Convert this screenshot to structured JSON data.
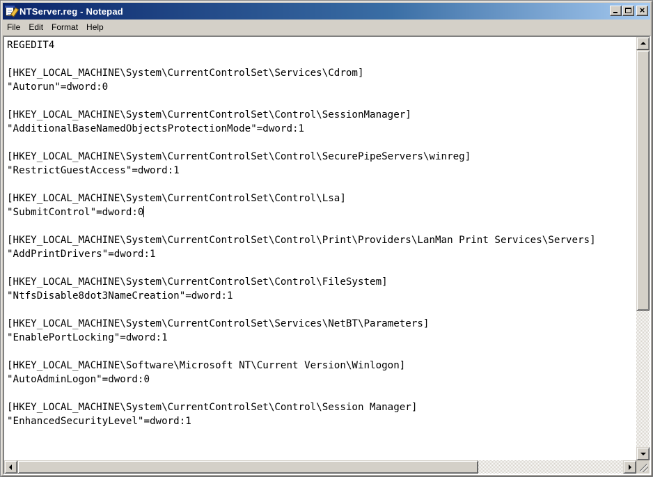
{
  "window": {
    "title": "NTServer.reg - Notepad",
    "colors": {
      "titlebar_active": "#0a246a",
      "titlebar_gradient_end": "#a6caf0",
      "chrome": "#d4d0c8"
    }
  },
  "menu": {
    "items": [
      {
        "label": "File"
      },
      {
        "label": "Edit"
      },
      {
        "label": "Format"
      },
      {
        "label": "Help"
      }
    ]
  },
  "editor": {
    "lines": [
      "REGEDIT4",
      "",
      "[HKEY_LOCAL_MACHINE\\System\\CurrentControlSet\\Services\\Cdrom]",
      "\"Autorun\"=dword:0",
      "",
      "[HKEY_LOCAL_MACHINE\\System\\CurrentControlSet\\Control\\SessionManager]",
      "\"AdditionalBaseNamedObjectsProtectionMode\"=dword:1",
      "",
      "[HKEY_LOCAL_MACHINE\\System\\CurrentControlSet\\Control\\SecurePipeServers\\winreg]",
      "\"RestrictGuestAccess\"=dword:1",
      "",
      "[HKEY_LOCAL_MACHINE\\System\\CurrentControlSet\\Control\\Lsa]",
      "\"SubmitControl\"=dword:0",
      "",
      "[HKEY_LOCAL_MACHINE\\System\\CurrentControlSet\\Control\\Print\\Providers\\LanMan Print Services\\Servers]",
      "\"AddPrintDrivers\"=dword:1",
      "",
      "[HKEY_LOCAL_MACHINE\\System\\CurrentControlSet\\Control\\FileSystem]",
      "\"NtfsDisable8dot3NameCreation\"=dword:1",
      "",
      "[HKEY_LOCAL_MACHINE\\System\\CurrentControlSet\\Services\\NetBT\\Parameters]",
      "\"EnablePortLocking\"=dword:1",
      "",
      "[HKEY_LOCAL_MACHINE\\Software\\Microsoft NT\\Current Version\\Winlogon]",
      "\"AutoAdminLogon\"=dword:0",
      "",
      "[HKEY_LOCAL_MACHINE\\System\\CurrentControlSet\\Control\\Session Manager]",
      "\"EnhancedSecurityLevel\"=dword:1"
    ],
    "caret_line": 12
  },
  "icons": {
    "app": "notepad-icon",
    "minimize": "minimize-icon",
    "maximize": "maximize-icon",
    "close": "close-icon"
  }
}
